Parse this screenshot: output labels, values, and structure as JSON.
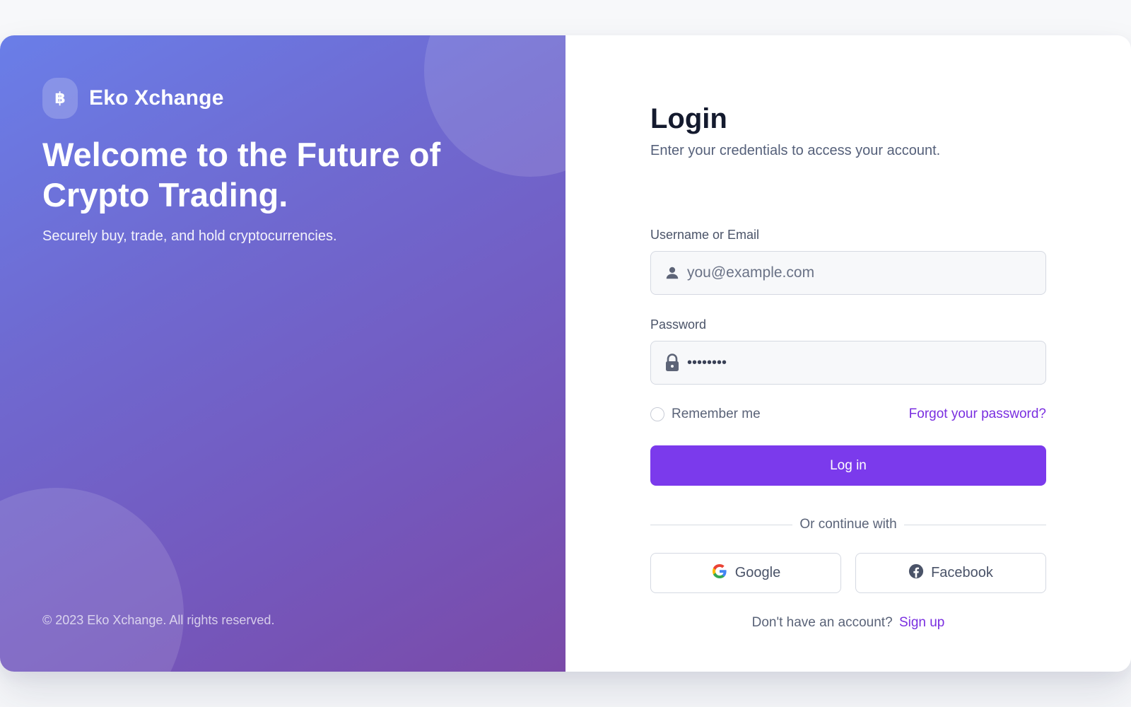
{
  "brand": {
    "logo_glyph": "฿",
    "name": "Eko Xchange"
  },
  "hero": {
    "title": "Welcome to the Future of Crypto Trading.",
    "subtitle": "Securely buy, trade, and hold cryptocurrencies."
  },
  "footer": {
    "copyright": "© 2023 Eko Xchange. All rights reserved."
  },
  "login": {
    "title": "Login",
    "subtitle": "Enter your credentials to access your account.",
    "username_label": "Username or Email",
    "username_placeholder": "you@example.com",
    "username_value": "",
    "password_label": "Password",
    "password_value": "••••••••",
    "remember_label": "Remember me",
    "remember_checked": false,
    "forgot_label": "Forgot your password?",
    "submit_label": "Log in",
    "divider_text": "Or continue with",
    "google_label": "Google",
    "facebook_label": "Facebook",
    "signup_prompt": "Don't have an account?",
    "signup_label": "Sign up"
  },
  "colors": {
    "accent": "#7b3aec",
    "link": "#7a2fe0",
    "gradient_start": "#6a7ee8",
    "gradient_end": "#7a4aa8"
  },
  "icons": {
    "username": "user-icon",
    "password": "lock-icon",
    "google": "google-icon",
    "facebook": "facebook-icon",
    "logo": "bitcoin-icon"
  }
}
